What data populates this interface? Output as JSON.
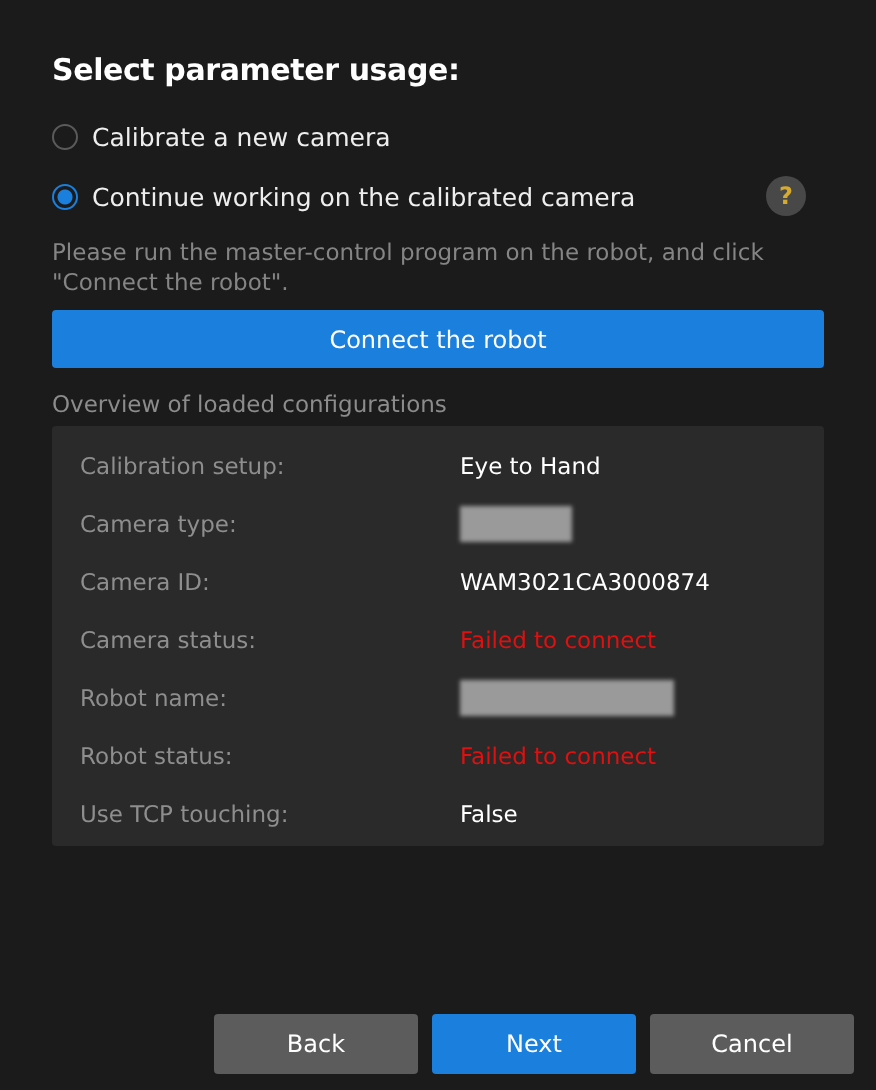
{
  "title": "Select parameter usage:",
  "options": [
    {
      "label": "Calibrate a new camera",
      "selected": false
    },
    {
      "label": "Continue working on the calibrated camera",
      "selected": true
    }
  ],
  "help": {
    "label": "?"
  },
  "hint": "Please run the master-control program on the robot, and click \"Connect the robot\".",
  "connect_button": "Connect the robot",
  "overview": {
    "title": "Overview of loaded configurations",
    "rows": [
      {
        "label": "Calibration setup:",
        "kind": "text",
        "value": "Eye to Hand"
      },
      {
        "label": "Camera type:",
        "kind": "redacted"
      },
      {
        "label": "Camera ID:",
        "kind": "text",
        "value": "WAM3021CA3000874"
      },
      {
        "label": "Camera status:",
        "kind": "error",
        "value": "Failed to connect"
      },
      {
        "label": "Robot name:",
        "kind": "redacted"
      },
      {
        "label": "Robot status:",
        "kind": "error",
        "value": "Failed to connect"
      },
      {
        "label": "Use TCP touching:",
        "kind": "text",
        "value": "False"
      }
    ]
  },
  "buttons": [
    {
      "label": "Back",
      "kind": "secondary"
    },
    {
      "label": "Next",
      "kind": "primary"
    },
    {
      "label": "Cancel",
      "kind": "secondary"
    }
  ]
}
